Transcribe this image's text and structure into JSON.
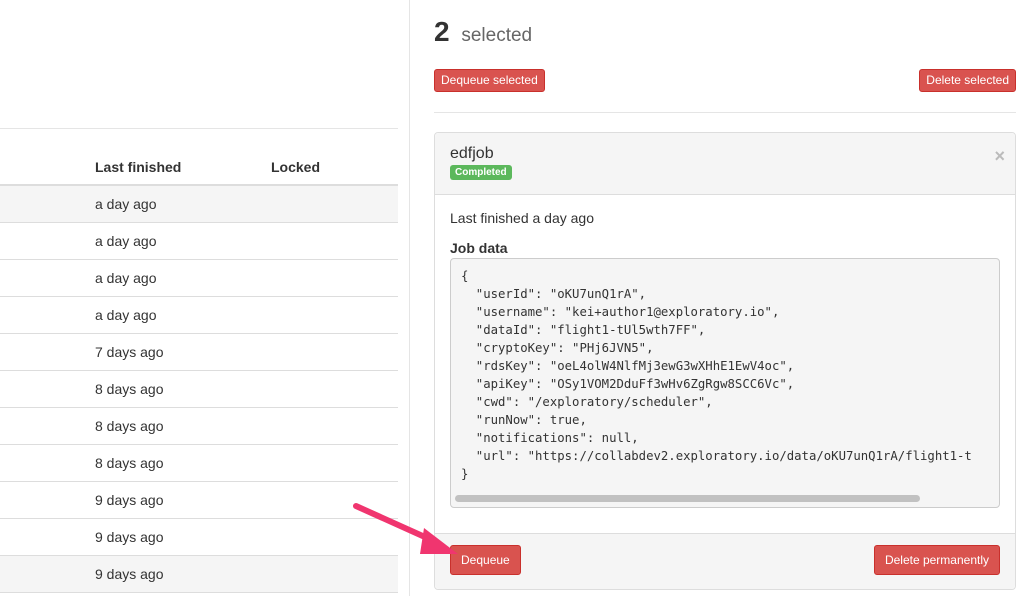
{
  "table": {
    "headers": {
      "last_finished": "Last finished",
      "locked": "Locked"
    },
    "rows": [
      {
        "last_finished": "a day ago",
        "striped": true
      },
      {
        "last_finished": "a day ago",
        "striped": false
      },
      {
        "last_finished": "a day ago",
        "striped": false
      },
      {
        "last_finished": "a day ago",
        "striped": false
      },
      {
        "last_finished": "7 days ago",
        "striped": false
      },
      {
        "last_finished": "8 days ago",
        "striped": false
      },
      {
        "last_finished": "8 days ago",
        "striped": false
      },
      {
        "last_finished": "8 days ago",
        "striped": false
      },
      {
        "last_finished": "9 days ago",
        "striped": false
      },
      {
        "last_finished": "9 days ago",
        "striped": false
      },
      {
        "last_finished": "9 days ago",
        "striped": true
      }
    ]
  },
  "selection": {
    "count": "2",
    "label": "selected",
    "dequeue_selected": "Dequeue selected",
    "delete_selected": "Delete selected"
  },
  "job": {
    "name": "edfjob",
    "status": "Completed",
    "last_finished": "Last finished a day ago",
    "job_data_label": "Job data",
    "job_data_lines": [
      "{",
      "  \"userId\": \"oKU7unQ1rA\",",
      "  \"username\": \"kei+author1@exploratory.io\",",
      "  \"dataId\": \"flight1-tUl5wth7FF\",",
      "  \"cryptoKey\": \"PHj6JVN5\",",
      "  \"rdsKey\": \"oeL4olW4NlfMj3ewG3wXHhE1EwV4oc\",",
      "  \"apiKey\": \"OSy1VOM2DduFf3wHv6ZgRgw8SCC6Vc\",",
      "  \"cwd\": \"/exploratory/scheduler\",",
      "  \"runNow\": true,",
      "  \"notifications\": null,",
      "  \"url\": \"https://collabdev2.exploratory.io/data/oKU7unQ1rA/flight1-t",
      "}"
    ],
    "close_icon": "×",
    "dequeue": "Dequeue",
    "delete_permanently": "Delete permanently"
  },
  "colors": {
    "danger": "#d9534f",
    "success": "#5cb85c",
    "arrow": "#f0356f"
  }
}
